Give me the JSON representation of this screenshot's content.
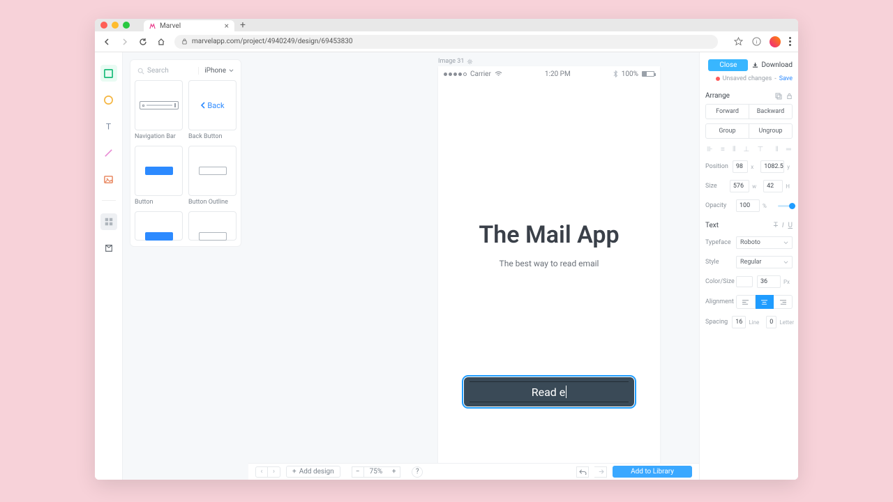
{
  "browser": {
    "tab_title": "Marvel",
    "url": "marvelapp.com/project/4940249/design/69453830"
  },
  "tool_rail": {
    "rect": "rect-icon",
    "circle": "circle-icon",
    "text": "text-icon",
    "line": "line-icon",
    "image": "image-icon",
    "library": "library-icon"
  },
  "left_panel": {
    "search_placeholder": "Search",
    "platform": "iPhone",
    "components": [
      {
        "label": "Navigation Bar"
      },
      {
        "label": "Back Button",
        "back_text": "Back"
      },
      {
        "label": "Button"
      },
      {
        "label": "Button Outline"
      }
    ]
  },
  "canvas": {
    "layer_label": "Image 31",
    "status": {
      "carrier": "Carrier",
      "time": "1:20 PM",
      "battery": "100%"
    },
    "title": "The Mail App",
    "subtitle": "The best way to read email",
    "cta": "Read e"
  },
  "bottom": {
    "add_design": "Add design",
    "zoom": "75%",
    "add_to_library": "Add to Library"
  },
  "right": {
    "close": "Close",
    "download": "Download",
    "unsaved": "Unsaved changes",
    "save": "Save",
    "sections": {
      "arrange": "Arrange",
      "text": "Text"
    },
    "arrange": {
      "forward": "Forward",
      "backward": "Backward",
      "group": "Group",
      "ungroup": "Ungroup",
      "position_label": "Position",
      "x": "98",
      "y": "1082.5",
      "size_label": "Size",
      "w": "576",
      "h": "42",
      "opacity_label": "Opacity",
      "opacity": "100"
    },
    "text": {
      "typeface_label": "Typeface",
      "typeface": "Roboto",
      "style_label": "Style",
      "style": "Regular",
      "colorsize_label": "Color/Size",
      "size": "36",
      "alignment_label": "Alignment",
      "spacing_label": "Spacing",
      "line": "16",
      "line_unit": "Line",
      "letter": "0",
      "letter_unit": "Letter"
    }
  }
}
